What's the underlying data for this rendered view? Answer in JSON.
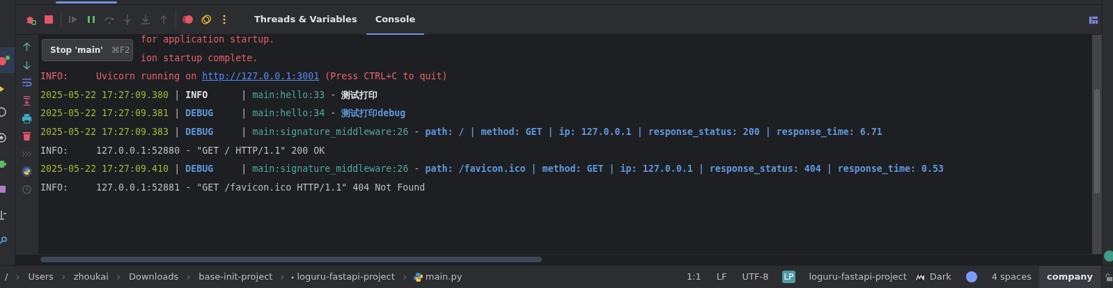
{
  "toolbar": {
    "buttons": [
      {
        "kind": "debug",
        "disabled": false
      },
      {
        "kind": "stop",
        "disabled": false
      },
      {
        "kind": "resume",
        "disabled": true
      },
      {
        "kind": "pause",
        "disabled": false
      },
      {
        "kind": "step_over",
        "disabled": true
      },
      {
        "kind": "step_into",
        "disabled": true
      },
      {
        "kind": "force_step_into",
        "disabled": true
      },
      {
        "kind": "step_out",
        "disabled": true
      },
      {
        "kind": "breakpoints",
        "disabled": false
      },
      {
        "kind": "mute",
        "disabled": false
      },
      {
        "kind": "more",
        "disabled": false
      }
    ],
    "tabs": [
      {
        "label": "Threads & Variables",
        "selected": false
      },
      {
        "label": "Console",
        "selected": true
      }
    ]
  },
  "tooltip": {
    "text": "Stop 'main'",
    "shortcut": "⌘F2"
  },
  "gutter_buttons": [
    {
      "kind": "up",
      "disabled": false
    },
    {
      "kind": "down",
      "disabled": false
    },
    {
      "kind": "wrap",
      "disabled": false
    },
    {
      "kind": "scroll_end",
      "disabled": false
    },
    {
      "kind": "print",
      "disabled": false
    },
    {
      "kind": "clear",
      "disabled": false
    },
    {
      "kind": "prompt",
      "disabled": true
    },
    {
      "kind": "python",
      "disabled": false
    },
    {
      "kind": "history",
      "disabled": true
    }
  ],
  "console_lines": [
    {
      "segments": [
        {
          "kind": "error",
          "text": "                  for application startup."
        }
      ]
    },
    {
      "segments": [
        {
          "kind": "error",
          "text": "                  ion startup complete."
        }
      ]
    },
    {
      "segments": [
        {
          "kind": "error",
          "text": "INFO:     Uvicorn running on "
        },
        {
          "kind": "link",
          "text": "http://127.0.0.1:3001"
        },
        {
          "kind": "error",
          "text": " (Press CTRL+C to quit)"
        }
      ]
    },
    {
      "segments": [
        {
          "kind": "time",
          "text": "2025-05-22 17:27:09.380"
        },
        {
          "kind": "plain",
          "text": " | "
        },
        {
          "kind": "level_info",
          "text": "INFO"
        },
        {
          "kind": "plain",
          "text": "      | "
        },
        {
          "kind": "source",
          "text": "main:hello:33"
        },
        {
          "kind": "plain",
          "text": " - "
        },
        {
          "kind": "msg_info",
          "text": "测试打印"
        }
      ]
    },
    {
      "segments": [
        {
          "kind": "time",
          "text": "2025-05-22 17:27:09.381"
        },
        {
          "kind": "plain",
          "text": " | "
        },
        {
          "kind": "level_debug",
          "text": "DEBUG"
        },
        {
          "kind": "plain",
          "text": "     | "
        },
        {
          "kind": "source",
          "text": "main:hello:34"
        },
        {
          "kind": "plain",
          "text": " - "
        },
        {
          "kind": "msg_debug",
          "text": "测试打印debug"
        }
      ]
    },
    {
      "segments": [
        {
          "kind": "time",
          "text": "2025-05-22 17:27:09.383"
        },
        {
          "kind": "plain",
          "text": " | "
        },
        {
          "kind": "level_debug",
          "text": "DEBUG"
        },
        {
          "kind": "plain",
          "text": "     | "
        },
        {
          "kind": "source",
          "text": "main:signature_middleware:26"
        },
        {
          "kind": "plain",
          "text": " - "
        },
        {
          "kind": "msg_debug",
          "text": "path: / | method: GET | ip: 127.0.0.1 | response_status: 200 | response_time: 6.71"
        }
      ]
    },
    {
      "segments": [
        {
          "kind": "plain",
          "text": "INFO:     127.0.0.1:52880 - \"GET / HTTP/1.1\" 200 OK"
        }
      ]
    },
    {
      "segments": [
        {
          "kind": "time",
          "text": "2025-05-22 17:27:09.410"
        },
        {
          "kind": "plain",
          "text": " | "
        },
        {
          "kind": "level_debug",
          "text": "DEBUG"
        },
        {
          "kind": "plain",
          "text": "     | "
        },
        {
          "kind": "source",
          "text": "main:signature_middleware:26"
        },
        {
          "kind": "plain",
          "text": " - "
        },
        {
          "kind": "msg_debug",
          "text": "path: /favicon.ico | method: GET | ip: 127.0.0.1 | response_status: 404 | response_time: 0.53"
        }
      ]
    },
    {
      "segments": [
        {
          "kind": "plain",
          "text": "INFO:     127.0.0.1:52881 - \"GET /favicon.ico HTTP/1.1\" 404 Not Found"
        }
      ]
    }
  ],
  "status_bar": {
    "breadcrumb": [
      {
        "kind": "folder",
        "text": "/"
      },
      {
        "kind": "folder",
        "text": "Users"
      },
      {
        "kind": "folder",
        "text": "zhoukai"
      },
      {
        "kind": "folder",
        "text": "Downloads"
      },
      {
        "kind": "folder",
        "text": "base-init-project"
      },
      {
        "kind": "module",
        "text": "loguru-fastapi-project"
      },
      {
        "kind": "file",
        "text": "main.py"
      }
    ],
    "items": [
      {
        "kind": "text",
        "text": "1:1"
      },
      {
        "kind": "text",
        "text": "LF"
      },
      {
        "kind": "text",
        "text": "UTF-8"
      },
      {
        "kind": "badge",
        "text": "LP"
      },
      {
        "kind": "text",
        "text": "loguru-fastapi-project"
      },
      {
        "kind": "theme",
        "text": "Dark"
      },
      {
        "kind": "dot"
      },
      {
        "kind": "text",
        "text": "4 spaces"
      },
      {
        "kind": "highlight",
        "text": "company"
      },
      {
        "kind": "lock"
      }
    ]
  }
}
